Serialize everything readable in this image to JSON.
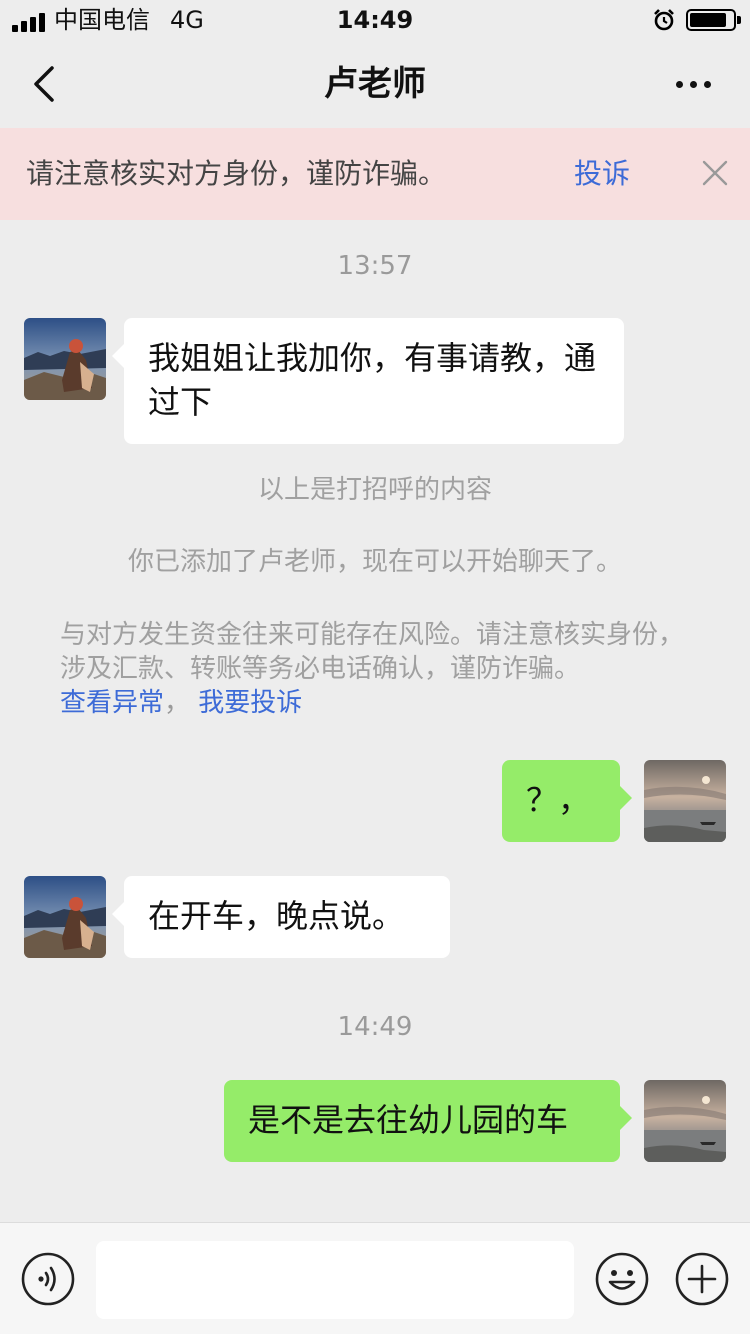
{
  "status_bar": {
    "carrier": "中国电信",
    "network": "4G",
    "time": "14:49",
    "battery_level": 0.85
  },
  "nav": {
    "title": "卢老师"
  },
  "banner": {
    "text": "请注意核实对方身份，谨防诈骗。",
    "link": "投诉"
  },
  "chat": {
    "timestamp_1": "13:57",
    "msg_1": "我姐姐让我加你，有事请教，通过下",
    "greeting_note": "以上是打招呼的内容",
    "added_note": "你已添加了卢老师，现在可以开始聊天了。",
    "risk_note": "与对方发生资金往来可能存在风险。请注意核实身份，涉及汇款、转账等务必电话确认，谨防诈骗。",
    "risk_link_1": "查看异常",
    "risk_sep": "，",
    "risk_link_2": "我要投诉",
    "msg_2": "？，",
    "msg_3": "在开车，晚点说。",
    "timestamp_2": "14:49",
    "msg_4": "是不是去往幼儿园的车"
  },
  "input": {
    "value": ""
  },
  "colors": {
    "chat_bg": "#ededed",
    "outgoing_bubble": "#95ec69",
    "incoming_bubble": "#ffffff",
    "banner_bg": "#f7dfdf",
    "link": "#3d6bd7"
  }
}
